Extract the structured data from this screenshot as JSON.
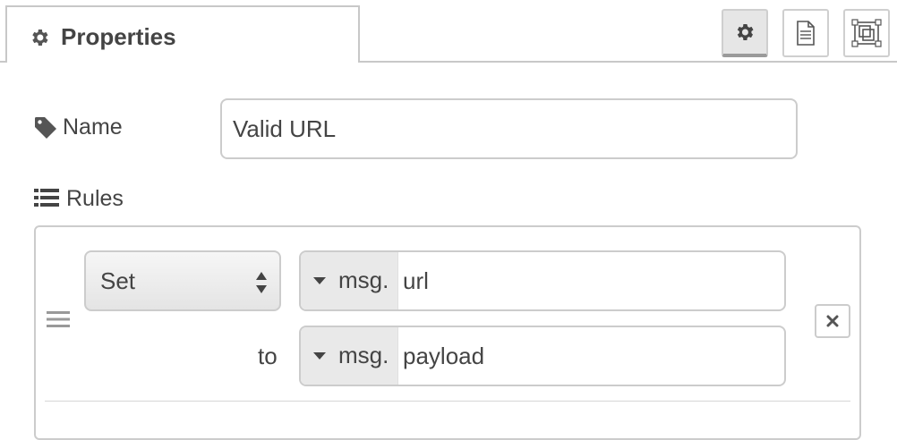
{
  "tabs": {
    "properties_label": "Properties"
  },
  "toolbar": {
    "buttons": [
      {
        "name": "node-settings",
        "icon": "gear-icon",
        "active": true
      },
      {
        "name": "node-description",
        "icon": "file-text-icon",
        "active": false
      },
      {
        "name": "node-appearance",
        "icon": "window-restore-icon",
        "active": false
      }
    ]
  },
  "form": {
    "name_label": "Name",
    "name_value": "Valid URL",
    "rules_label": "Rules"
  },
  "rule": {
    "action": "Set",
    "target_prefix": "msg.",
    "target_value": "url",
    "to_label": "to",
    "source_prefix": "msg.",
    "source_value": "payload"
  },
  "colors": {
    "border": "#cccccc",
    "text": "#444444",
    "active_button_bg": "#e6e6e6"
  }
}
